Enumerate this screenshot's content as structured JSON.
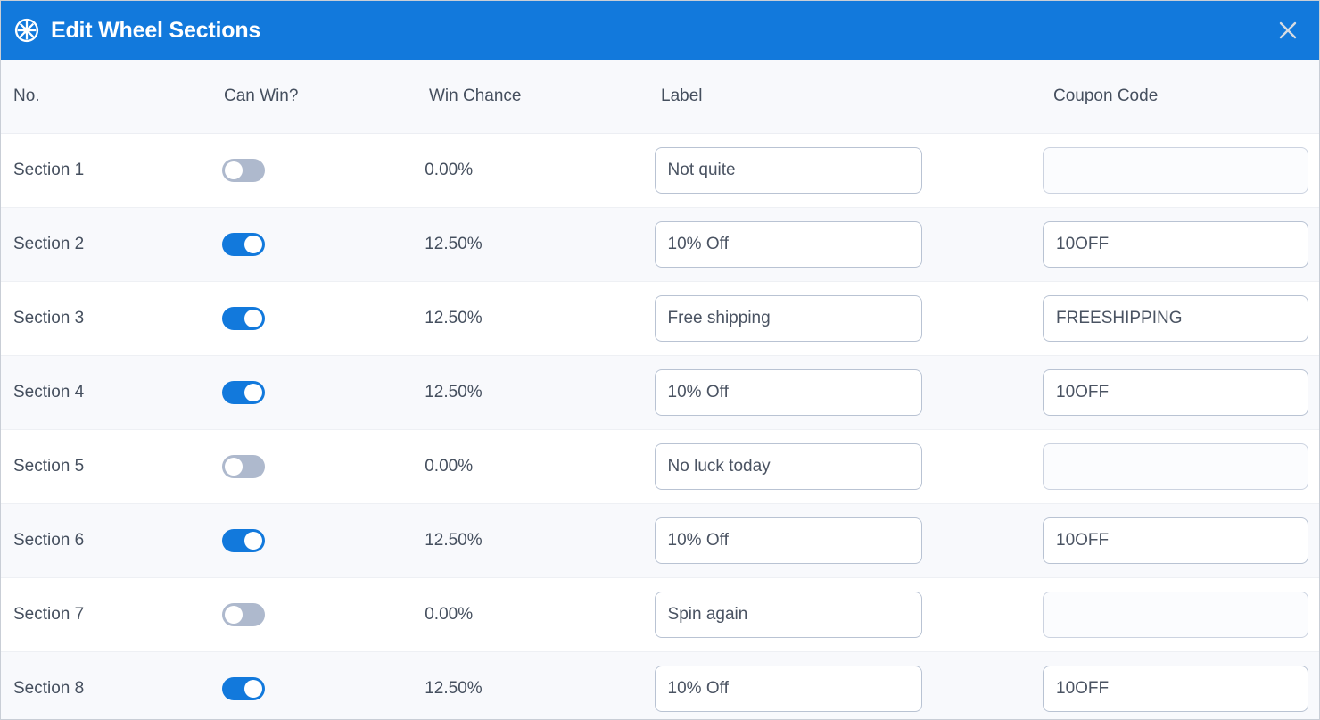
{
  "window": {
    "title": "Edit Wheel Sections",
    "icon": "wheel-icon",
    "close_icon": "close-icon",
    "header_bg": "#1279dc",
    "header_text_color": "#ffffff"
  },
  "table": {
    "columns": [
      {
        "key": "no",
        "label": "No."
      },
      {
        "key": "can_win",
        "label": "Can Win?"
      },
      {
        "key": "chance",
        "label": "Win Chance"
      },
      {
        "key": "label",
        "label": "Label"
      },
      {
        "key": "coupon",
        "label": "Coupon Code"
      }
    ],
    "colors": {
      "header_row_bg": "#f8f9fc",
      "row_bg": "#ffffff",
      "row_alt_bg": "#f8f9fc",
      "text": "#454f5e",
      "toggle_on": "#1279dc",
      "toggle_off": "#aeb9cd",
      "input_border": "#b9c3d3"
    },
    "rows": [
      {
        "no": "Section 1",
        "can_win": false,
        "chance": "0.00%",
        "label": "Not quite",
        "label_placeholder": "",
        "coupon": "",
        "coupon_placeholder": ""
      },
      {
        "no": "Section 2",
        "can_win": true,
        "chance": "12.50%",
        "label": "10% Off",
        "label_placeholder": "",
        "coupon": "10OFF",
        "coupon_placeholder": ""
      },
      {
        "no": "Section 3",
        "can_win": true,
        "chance": "12.50%",
        "label": "Free shipping",
        "label_placeholder": "",
        "coupon": "FREESHIPPING",
        "coupon_placeholder": ""
      },
      {
        "no": "Section 4",
        "can_win": true,
        "chance": "12.50%",
        "label": "10% Off",
        "label_placeholder": "",
        "coupon": "10OFF",
        "coupon_placeholder": ""
      },
      {
        "no": "Section 5",
        "can_win": false,
        "chance": "0.00%",
        "label": "No luck today",
        "label_placeholder": "",
        "coupon": "",
        "coupon_placeholder": ""
      },
      {
        "no": "Section 6",
        "can_win": true,
        "chance": "12.50%",
        "label": "10% Off",
        "label_placeholder": "",
        "coupon": "10OFF",
        "coupon_placeholder": ""
      },
      {
        "no": "Section 7",
        "can_win": false,
        "chance": "0.00%",
        "label": "Spin again",
        "label_placeholder": "",
        "coupon": "",
        "coupon_placeholder": ""
      },
      {
        "no": "Section 8",
        "can_win": true,
        "chance": "12.50%",
        "label": "10% Off",
        "label_placeholder": "",
        "coupon": "10OFF",
        "coupon_placeholder": ""
      }
    ]
  }
}
